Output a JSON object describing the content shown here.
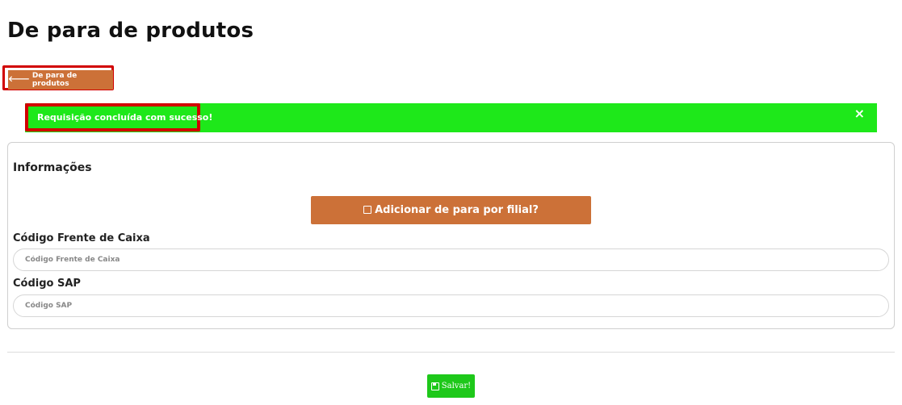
{
  "page": {
    "title": "De para de produtos"
  },
  "back_button": {
    "icon": "arrow-left-icon",
    "label": "De para de produtos"
  },
  "alert": {
    "message": "Requisição concluída com sucesso!",
    "close": "×",
    "color": "#1ee81a"
  },
  "card": {
    "title": "Informações",
    "branch_button": {
      "icon": "checkbox-icon",
      "label": "Adicionar de para por filial?"
    },
    "fields": [
      {
        "label": "Código Frente de Caixa",
        "placeholder": "Código Frente de Caixa",
        "value": ""
      },
      {
        "label": "Código SAP",
        "placeholder": "Código SAP",
        "value": ""
      }
    ]
  },
  "save_button": {
    "icon": "floppy-disk-icon",
    "label": "Salvar!"
  },
  "colors": {
    "accent": "#cc7138",
    "success": "#1ee81a",
    "save": "#1ec81a",
    "highlight": "#d10000"
  }
}
